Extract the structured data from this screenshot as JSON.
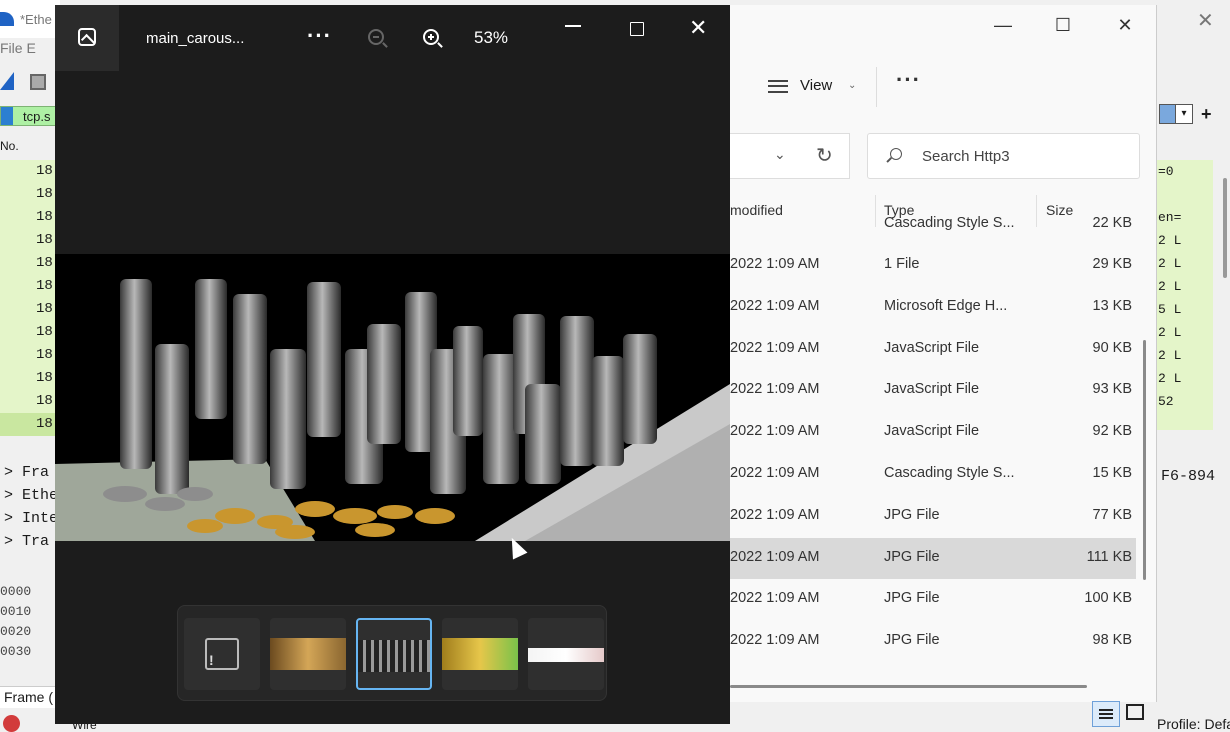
{
  "wireshark": {
    "title": "*Ethe",
    "menu": "File   E",
    "filter": "tcp.s",
    "col_no": "No.",
    "rows": [
      "18",
      "18",
      "18",
      "18",
      "18",
      "18",
      "18",
      "18",
      "18",
      "18",
      "18",
      "18"
    ],
    "detail": [
      "Fra",
      "Ethe",
      "Inte",
      "Tra"
    ],
    "hex_offsets": [
      "0000",
      "0010",
      "0020",
      "0030"
    ],
    "status": "Frame (",
    "bottom_label": "Wire",
    "right_rows": [
      "=0",
      "",
      "en=",
      "2 L",
      "2 L",
      "2 L",
      "5 L",
      "2 L",
      "2 L",
      "2 L",
      "52"
    ],
    "right_hex": "F6-894",
    "profile": "Profile: Default"
  },
  "explorer": {
    "view_label": "View",
    "search_placeholder": "Search Http3",
    "columns": {
      "modified": "modified",
      "type": "Type",
      "size": "Size"
    },
    "rows": [
      {
        "date": "",
        "type": "Cascading Style S...",
        "size": "22 KB"
      },
      {
        "date": "2022 1:09 AM",
        "type": "1 File",
        "size": "29 KB"
      },
      {
        "date": "2022 1:09 AM",
        "type": "Microsoft Edge H...",
        "size": "13 KB"
      },
      {
        "date": "2022 1:09 AM",
        "type": "JavaScript File",
        "size": "90 KB"
      },
      {
        "date": "2022 1:09 AM",
        "type": "JavaScript File",
        "size": "93 KB"
      },
      {
        "date": "2022 1:09 AM",
        "type": "JavaScript File",
        "size": "92 KB"
      },
      {
        "date": "2022 1:09 AM",
        "type": "Cascading Style S...",
        "size": "15 KB"
      },
      {
        "date": "2022 1:09 AM",
        "type": "JPG File",
        "size": "77 KB"
      },
      {
        "date": "2022 1:09 AM",
        "type": "JPG File",
        "size": "111 KB"
      },
      {
        "date": "2022 1:09 AM",
        "type": "JPG File",
        "size": "100 KB"
      },
      {
        "date": "2022 1:09 AM",
        "type": "JPG File",
        "size": "98 KB"
      }
    ],
    "first_row_date": "2022 1:09 AM",
    "selected_row_index": 8
  },
  "photos": {
    "file_name": "main_carous...",
    "zoom": "53%",
    "thumbnails": [
      {
        "kind": "broken",
        "icon": "broken-image-icon"
      },
      {
        "kind": "image",
        "color": "#b8864a"
      },
      {
        "kind": "image",
        "color": "#555555",
        "selected": true
      },
      {
        "kind": "image",
        "color": "#c9a42a"
      },
      {
        "kind": "image",
        "color": "#e8e8e8"
      }
    ]
  }
}
